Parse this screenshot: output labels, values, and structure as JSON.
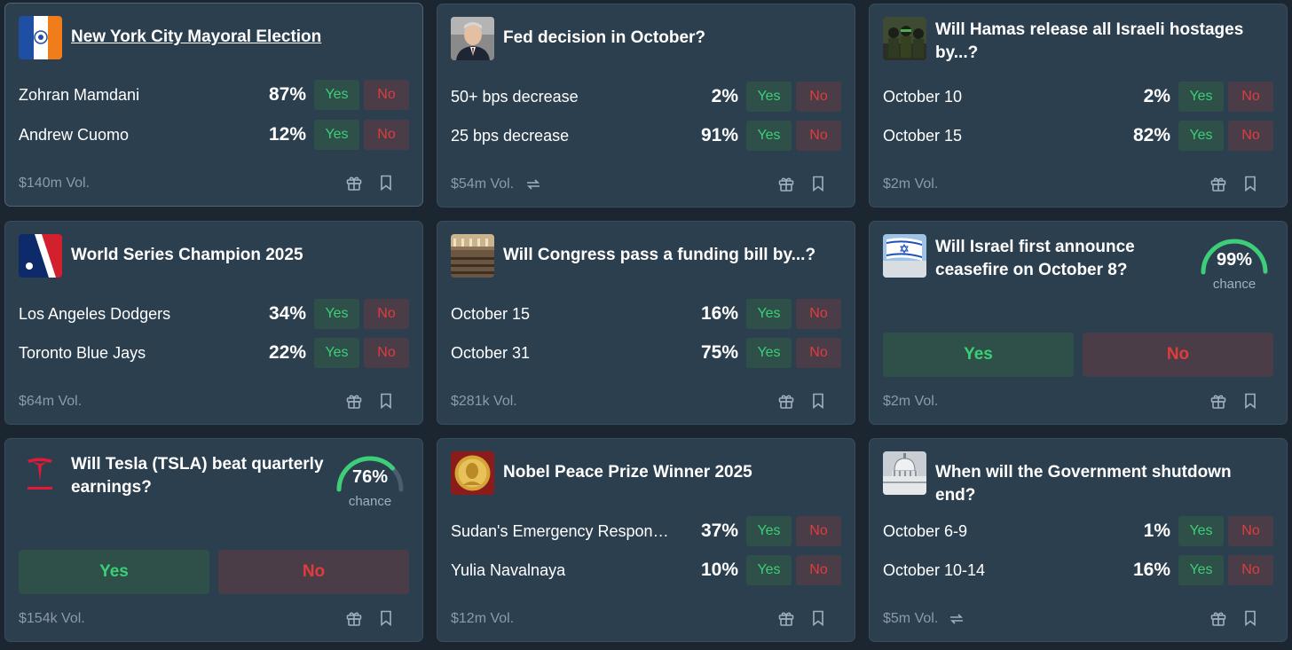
{
  "colors": {
    "background": "#1b2631",
    "card": "#2c3f4f",
    "yes_text": "#3ccf78",
    "yes_bg": "#2e5049",
    "no_text": "#e13c3c",
    "no_bg": "#4a3d48",
    "muted": "#8a9bab"
  },
  "cards": [
    {
      "title": "New York City Mayoral Election",
      "icon": "nyc-flag-icon",
      "outcomes": [
        {
          "label": "Zohran Mamdani",
          "pct": "87%",
          "yes": "Yes",
          "no": "No"
        },
        {
          "label": "Andrew Cuomo",
          "pct": "12%",
          "yes": "Yes",
          "no": "No"
        }
      ],
      "volume": "$140m Vol."
    },
    {
      "title": "Fed decision in October?",
      "icon": "fed-chair-icon",
      "outcomes": [
        {
          "label": "50+ bps decrease",
          "pct": "2%",
          "yes": "Yes",
          "no": "No"
        },
        {
          "label": "25 bps decrease",
          "pct": "91%",
          "yes": "Yes",
          "no": "No"
        }
      ],
      "volume": "$54m Vol.",
      "recurring": true
    },
    {
      "title": "Will Hamas release all Israeli hostages by...?",
      "icon": "hamas-photo-icon",
      "outcomes": [
        {
          "label": "October 10",
          "pct": "2%",
          "yes": "Yes",
          "no": "No"
        },
        {
          "label": "October 15",
          "pct": "82%",
          "yes": "Yes",
          "no": "No"
        }
      ],
      "volume": "$2m Vol."
    },
    {
      "title": "World Series Champion 2025",
      "icon": "mlb-logo-icon",
      "outcomes": [
        {
          "label": "Los Angeles Dodgers",
          "pct": "34%",
          "yes": "Yes",
          "no": "No"
        },
        {
          "label": "Toronto Blue Jays",
          "pct": "22%",
          "yes": "Yes",
          "no": "No"
        }
      ],
      "volume": "$64m Vol."
    },
    {
      "title": "Will Congress pass a funding bill by...?",
      "icon": "congress-chamber-icon",
      "outcomes": [
        {
          "label": "October 15",
          "pct": "16%",
          "yes": "Yes",
          "no": "No"
        },
        {
          "label": "October 31",
          "pct": "75%",
          "yes": "Yes",
          "no": "No"
        }
      ],
      "volume": "$281k Vol."
    },
    {
      "title": "Will Israel first announce ceasefire on October 8?",
      "icon": "israel-flag-icon",
      "chance": {
        "value": "99%",
        "label": "chance",
        "fraction": 0.99
      },
      "yes": "Yes",
      "no": "No",
      "volume": "$2m Vol."
    },
    {
      "title": "Will Tesla (TSLA) beat quarterly earnings?",
      "icon": "tesla-logo-icon",
      "chance": {
        "value": "76%",
        "label": "chance",
        "fraction": 0.76
      },
      "yes": "Yes",
      "no": "No",
      "volume": "$154k Vol."
    },
    {
      "title": "Nobel Peace Prize Winner 2025",
      "icon": "nobel-medal-icon",
      "outcomes": [
        {
          "label": "Sudan's Emergency Response...",
          "pct": "37%",
          "yes": "Yes",
          "no": "No"
        },
        {
          "label": "Yulia Navalnaya",
          "pct": "10%",
          "yes": "Yes",
          "no": "No"
        }
      ],
      "volume": "$12m Vol."
    },
    {
      "title": "When will the Government shutdown end?",
      "icon": "capitol-icon",
      "outcomes": [
        {
          "label": "October 6-9",
          "pct": "1%",
          "yes": "Yes",
          "no": "No"
        },
        {
          "label": "October 10-14",
          "pct": "16%",
          "yes": "Yes",
          "no": "No"
        }
      ],
      "volume": "$5m Vol.",
      "recurring": true
    }
  ]
}
